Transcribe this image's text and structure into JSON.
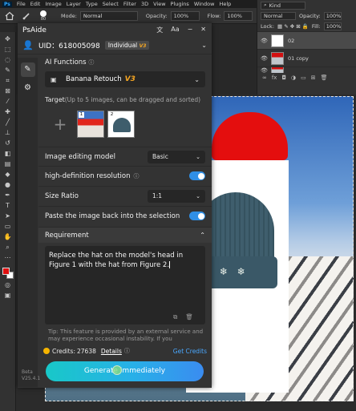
{
  "photoshop": {
    "logo": "Ps",
    "menu": [
      "File",
      "Edit",
      "Image",
      "Layer",
      "Type",
      "Select",
      "Filter",
      "3D",
      "View",
      "Plugins",
      "Window",
      "Help"
    ],
    "options": {
      "brush_size": "80",
      "mode_label": "Mode:",
      "mode_value": "Normal",
      "opacity_label": "Opacity:",
      "opacity_value": "100%",
      "flow_label": "Flow:",
      "flow_value": "100%"
    },
    "layers": {
      "kind_label": "Kind",
      "blend_mode": "Normal",
      "opacity_label": "Opacity:",
      "opacity_value": "100%",
      "lock_label": "Lock:",
      "fill_label": "Fill:",
      "fill_value": "100%",
      "items": [
        {
          "name": "02"
        },
        {
          "name": "01 copy"
        },
        {
          "name": "01"
        }
      ]
    }
  },
  "panel": {
    "title": "PsAide",
    "uid": "UID：618005098",
    "plan_label": "Individual",
    "plan_badge": "V3",
    "ai_functions_label": "AI Functions",
    "function_name": "Banana Retouch",
    "function_badge": "V3",
    "target_label": "Target",
    "target_hint": "(Up to 5 images, can be dragged and sorted)",
    "target_images": [
      "1",
      "2"
    ],
    "model_label": "Image editing model",
    "model_value": "Basic",
    "hd_label": "high-definition resolution",
    "hd_enabled": true,
    "size_ratio_label": "Size Ratio",
    "size_ratio_value": "1:1",
    "paste_back_label": "Paste the image back into the selection",
    "paste_back_enabled": true,
    "requirement_label": "Requirement",
    "requirement_text": "Replace the hat on the model's head in Figure 1 with the hat from Figure 2.",
    "tip_text": "Tip: This feature is provided by an external service and may experience occasional instability. If you",
    "credits_label": "Credits:",
    "credits_value": "27638",
    "details_label": "Details",
    "get_credits_label": "Get Credits",
    "generate_label": "Generate Immediately",
    "beta_label": "Beta",
    "version_label": "V25.4.1"
  },
  "colors": {
    "accent_blue": "#2f8fe6",
    "generate_gradient_start": "#18c8c8",
    "generate_gradient_end": "#3a8cf0",
    "badge_gold": "#f5a623",
    "foreground_color": "#e01010"
  }
}
